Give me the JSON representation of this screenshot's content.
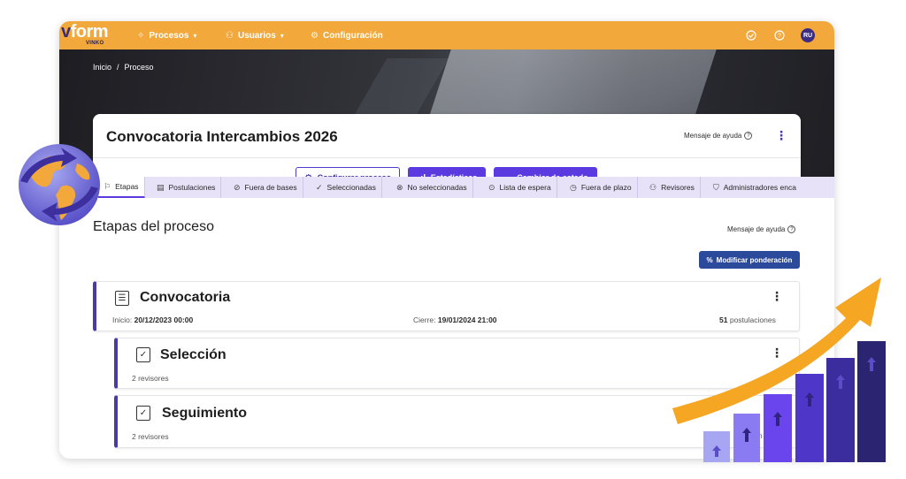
{
  "brand": {
    "logo_text": "form",
    "logo_v": "v",
    "logo_sub": "VINKO"
  },
  "topnav": {
    "items": [
      {
        "label": "Procesos",
        "icon": "process-icon",
        "has_dropdown": true
      },
      {
        "label": "Usuarios",
        "icon": "users-icon",
        "has_dropdown": true
      },
      {
        "label": "Configuración",
        "icon": "gear-icon",
        "has_dropdown": false
      }
    ],
    "right_icons": [
      "check-circle-icon",
      "help-circle-icon"
    ],
    "avatar_initials": "RU"
  },
  "breadcrumb": {
    "home": "Inicio",
    "separator": "/",
    "current": "Proceso"
  },
  "process": {
    "title": "Convocatoria Intercambios 2026",
    "help_label": "Mensaje de ayuda",
    "buttons": {
      "configure": "Configurar proceso",
      "stats": "Estadísticas",
      "change_state": "Cambiar de estado"
    }
  },
  "tabs": [
    {
      "label": "Etapas",
      "icon": "flag-icon",
      "active": true
    },
    {
      "label": "Postulaciones",
      "icon": "clipboard-icon",
      "active": false
    },
    {
      "label": "Fuera de bases",
      "icon": "ban-icon",
      "active": false
    },
    {
      "label": "Seleccionadas",
      "icon": "check-circle-icon",
      "active": false
    },
    {
      "label": "No seleccionadas",
      "icon": "x-circle-icon",
      "active": false
    },
    {
      "label": "Lista de espera",
      "icon": "clock-dots-icon",
      "active": false
    },
    {
      "label": "Fuera de plazo",
      "icon": "timer-off-icon",
      "active": false
    },
    {
      "label": "Revisores",
      "icon": "reviewers-icon",
      "active": false
    },
    {
      "label": "Administradores enca",
      "icon": "shield-icon",
      "active": false
    }
  ],
  "main": {
    "section_title": "Etapas del proceso",
    "help_label": "Mensaje de ayuda",
    "modify_button": "Modificar ponderación"
  },
  "stages": [
    {
      "name": "Convocatoria",
      "start_label": "Inicio:",
      "start_value": "20/12/2023 00:00",
      "end_label": "Cierre:",
      "end_value": "19/01/2024 21:00",
      "count_value": "51",
      "count_label": "postulaciones"
    },
    {
      "name": "Selección",
      "reviewers": "2 revisores",
      "partial": "s"
    },
    {
      "name": "Seguimiento",
      "reviewers": "2 revisores",
      "partial": "n"
    }
  ],
  "colors": {
    "topbar": "#f2a83b",
    "primary": "#5b3be0",
    "stage_accent": "#4a3aa8",
    "modify_button": "#2c4a9c",
    "tabs_bg": "#e8e2f8"
  }
}
